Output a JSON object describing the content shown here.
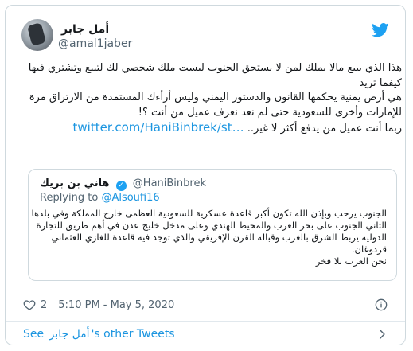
{
  "author": {
    "display_name": "أمل جابر",
    "handle": "@amal1jaber"
  },
  "tweet": {
    "lines": [
      "هذا الذي يبيع مالا يملك لمن لا يستحق الجنوب ليست ملك شخصي لك لتبيع وتشتري فيها",
      "كيفما تريد",
      "هي أرض يمنية يحكمها القانون والدستور اليمني وليس أرأءك المستمدة من الارتزاق مرة",
      "للإمارات وأخرى للسعودية حتى لم نعد نعرف عميل من أنت ؟!",
      "ربما أنت عميل من يدفع أكثر لا غير.."
    ],
    "link": "twitter.com/HaniBinbrek/st…"
  },
  "quoted": {
    "display_name": "هاني بن بريك",
    "handle": "@HaniBinbrek",
    "replying_prefix": "Replying to",
    "replying_to": "@Alsoufi16",
    "lines": [
      "الجنوب يرحب وبإذن الله تكون أكبر قاعدة عسكرية للسعودية العظمى خارج المملكة وفي بلدها",
      "الثاني الجنوب على بحر العرب والمحيط الهندي وعلى مدخل خليج عدن في أهم طريق للتجارة",
      "الدولية يربط الشرق بالغرب وقبالة القرن الإفريقي والذي توجد فيه قاعدة للغازي العثماني",
      "قردوغان.",
      "نحن العرب بلا فخر"
    ]
  },
  "meta": {
    "likes": "2",
    "timestamp": "5:10 PM - May 5, 2020"
  },
  "footer": {
    "see_prefix": "See",
    "name": "أمل جابر",
    "suffix": "'s other Tweets"
  },
  "colors": {
    "link": "#1b95e0",
    "brand": "#1da1f2",
    "muted": "#536471",
    "border": "#cfd9de"
  },
  "icons": [
    "twitter-bird-icon",
    "verified-icon",
    "heart-icon",
    "info-icon",
    "chevron-right-icon"
  ]
}
